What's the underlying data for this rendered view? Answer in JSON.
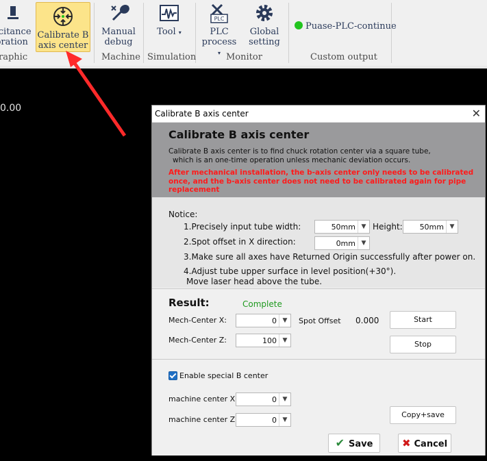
{
  "ribbon": {
    "buttons": [
      {
        "label1": "Capacitance",
        "label2": "calibration",
        "shown1": "acitance",
        "shown2": "bration"
      },
      {
        "label1": "Calibrate B",
        "label2": "axis center"
      },
      {
        "label1": "Manual",
        "label2": "debug"
      },
      {
        "label1": "Tool",
        "label2": ""
      },
      {
        "label1": "PLC",
        "label2": "process"
      },
      {
        "label1": "Global",
        "label2": "setting"
      }
    ],
    "plc_status": "Puase-PLC-continue",
    "groups": {
      "graphic": "raphic",
      "machine": "Machine",
      "simulation": "Simulation",
      "monitor": "Monitor",
      "custom": "Custom output"
    },
    "colors": {
      "active_bg": "#fce48a",
      "status_dot": "#22c41e"
    }
  },
  "canvas": {
    "coord_text": "0.00"
  },
  "dialog": {
    "title": "Calibrate B axis center",
    "heading": "Calibrate B axis center",
    "desc_line1": "Calibrate B axis center is to find chuck rotation center via a square tube,",
    "desc_line2": "which is an one-time operation unless mechanic deviation occurs.",
    "warning": "After mechanical installation, the b-axis center only needs to be calibrated once, and the b-axis center does not need to be calibrated again for pipe replacement",
    "notice": {
      "label": "Notice:",
      "item1": "1.Precisely input tube width:",
      "width_value": "50mm",
      "height_label": "Height:",
      "height_value": "50mm",
      "item2": "2.Spot offset in X direction:",
      "offset_value": "0mm",
      "item3": "3.Make sure all axes have Returned Origin successfully after power on.",
      "item4_line1": "4.Adjust tube upper surface in level position(+30°).",
      "item4_line2": "Move laser head above the tube."
    },
    "result": {
      "label": "Result:",
      "status": "Complete",
      "mech_x_label": "Mech-Center X:",
      "mech_x_value": "0",
      "mech_z_label": "Mech-Center Z:",
      "mech_z_value": "100",
      "spot_offset_label": "Spot Offset",
      "spot_offset_value": "0.000",
      "start_label": "Start",
      "stop_label": "Stop"
    },
    "special": {
      "enable_label": "Enable special B center",
      "machine_x_label": "machine center X:",
      "machine_x_value": "0",
      "machine_z_label": "machine center Z:",
      "machine_z_value": "0",
      "copy_save_label": "Copy+save"
    },
    "save_label": "Save",
    "cancel_label": "Cancel",
    "colors": {
      "header_bg": "#9a9a9c",
      "warning": "#ff1a1a",
      "complete": "#1f9a1f",
      "save_check": "#2a8a3a",
      "cancel_x": "#d11a1a"
    }
  }
}
